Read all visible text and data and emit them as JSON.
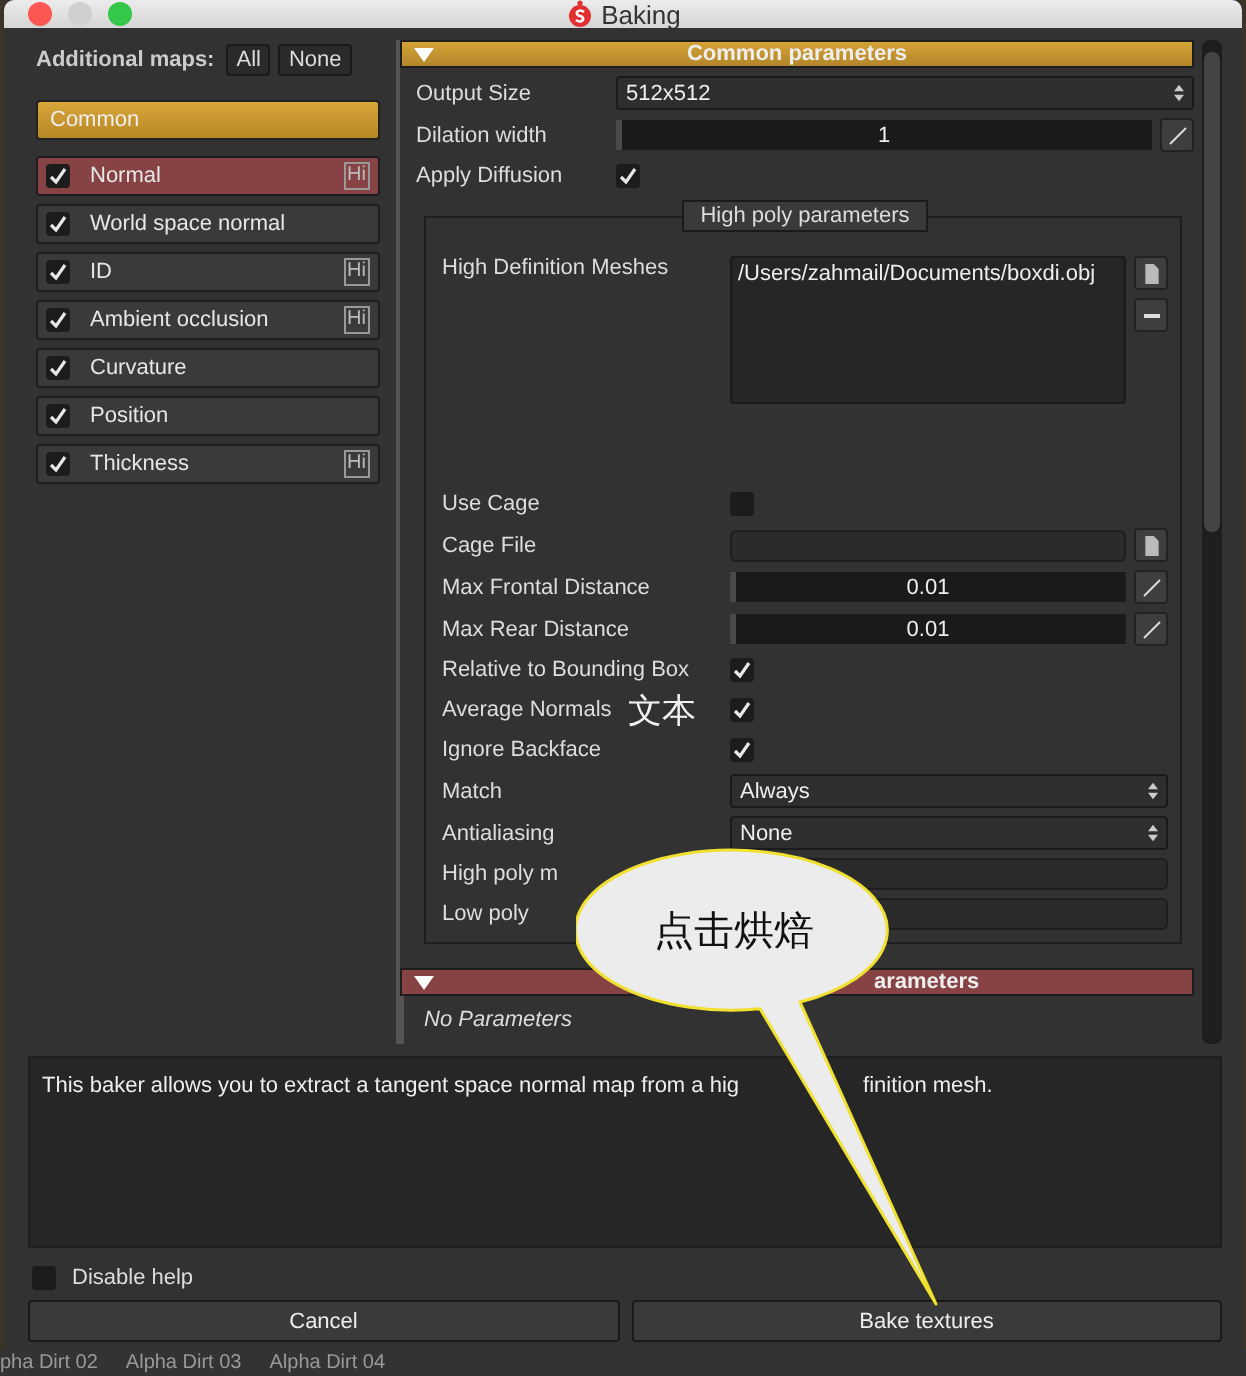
{
  "window": {
    "title": "Baking"
  },
  "sidebar": {
    "label": "Additional maps:",
    "buttons": [
      "All",
      "None"
    ],
    "group": {
      "label": "Common",
      "selected": true
    },
    "maps": [
      {
        "label": "Normal",
        "checked": true,
        "selected": true,
        "badge": "Hi"
      },
      {
        "label": "World space normal",
        "checked": true,
        "selected": false
      },
      {
        "label": "ID",
        "checked": true,
        "selected": false,
        "badge": "Hi"
      },
      {
        "label": "Ambient occlusion",
        "checked": true,
        "selected": false,
        "badge": "Hi"
      },
      {
        "label": "Curvature",
        "checked": true,
        "selected": false
      },
      {
        "label": "Position",
        "checked": true,
        "selected": false
      },
      {
        "label": "Thickness",
        "checked": true,
        "selected": false,
        "badge": "Hi"
      }
    ]
  },
  "common": {
    "title": "Common parameters",
    "expanded": true,
    "params": [
      {
        "kind": "select",
        "label": "Output Size",
        "value": "512x512"
      },
      {
        "kind": "number",
        "label": "Dilation width",
        "value": "1",
        "level": 0
      },
      {
        "kind": "checkbox",
        "label": "Apply Diffusion",
        "checked": true
      }
    ],
    "group": {
      "title": "High poly parameters",
      "params": [
        {
          "kind": "filelist",
          "label": "High Definition Meshes",
          "value": "/Users/zahmail/Documents/boxdi.obj"
        },
        {
          "kind": "checkbox",
          "label": "Use Cage",
          "checked": false
        },
        {
          "kind": "file",
          "label": "Cage File"
        },
        {
          "kind": "number",
          "label": "Max Frontal Distance",
          "value": "0.01",
          "level": 0
        },
        {
          "kind": "number",
          "label": "Max Rear Distance",
          "value": "0.01",
          "level": 0
        },
        {
          "kind": "checkbox",
          "label": "Relative to Bounding Box",
          "checked": true
        },
        {
          "kind": "checkbox",
          "label": "Average Normals",
          "checked": true
        },
        {
          "kind": "checkbox",
          "label": "Ignore Backface",
          "checked": true
        },
        {
          "kind": "select",
          "label": "Match",
          "value": "Always"
        },
        {
          "kind": "select",
          "label": "Antialiasing",
          "value": "None"
        },
        {
          "kind": "text",
          "label": "High poly m"
        },
        {
          "kind": "text",
          "label": "Low poly"
        }
      ]
    }
  },
  "map_section": {
    "title": "arameters",
    "expanded": true,
    "body": "No Parameters"
  },
  "help": {
    "text_before": "This baker allows you to extract a tangent space normal map from a hig",
    "text_after": "finition mesh."
  },
  "disable_help": {
    "label": "Disable help",
    "checked": false
  },
  "buttons": [
    "Cancel",
    "Bake textures"
  ],
  "background_tabs": [
    "pha Dirt 02",
    "Alpha Dirt 03",
    "Alpha Dirt 04"
  ],
  "annotations": {
    "note": "文本",
    "callout": "点击烘焙"
  }
}
